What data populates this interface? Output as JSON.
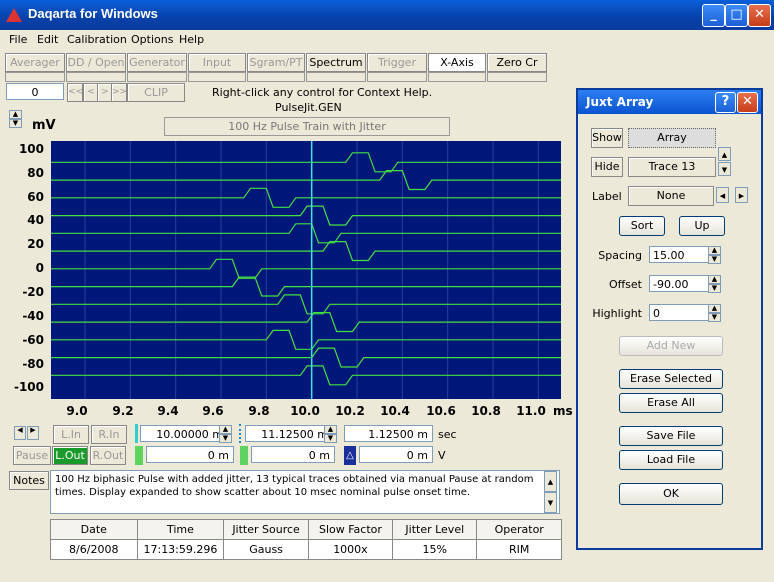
{
  "window": {
    "title": "Daqarta for Windows"
  },
  "menu": [
    "File",
    "Edit",
    "Calibration",
    "Options",
    "Help"
  ],
  "toolbar": {
    "buttons": [
      "Averager",
      "DD / Open",
      "Generator",
      "Input",
      "Sgram/PT",
      "Spectrum",
      "Trigger",
      "X-Axis",
      "Zero Cr"
    ],
    "counter": "0",
    "nav": [
      "<<",
      "<",
      ">",
      ">>"
    ],
    "clip": "CLIP",
    "help_text": "Right-click any control for Context Help.",
    "file_name": "PulseJit.GEN",
    "subtitle": "100 Hz Pulse Train with Jitter"
  },
  "y_unit": "mV",
  "x_unit": "ms",
  "chart_data": {
    "type": "line",
    "xlim": [
      8.85,
      11.1
    ],
    "ylim": [
      -110,
      108
    ],
    "x_ticks": [
      "9.0",
      "9.2",
      "9.4",
      "9.6",
      "9.8",
      "10.0",
      "10.2",
      "10.4",
      "10.6",
      "10.8",
      "11.0"
    ],
    "y_ticks": [
      "100",
      "80",
      "60",
      "40",
      "20",
      "0",
      "-20",
      "-40",
      "-60",
      "-80",
      "-100"
    ],
    "cursor_x": 10.0,
    "trace_color": "#40e040",
    "background": "#00177a",
    "series": [
      {
        "offset": 90,
        "onset": 10.15
      },
      {
        "offset": 75,
        "onset": 10.3
      },
      {
        "offset": 60,
        "onset": 9.7
      },
      {
        "offset": 45,
        "onset": 9.95
      },
      {
        "offset": 30,
        "onset": 9.9
      },
      {
        "offset": 15,
        "onset": 10.05
      },
      {
        "offset": 0,
        "onset": 9.55
      },
      {
        "offset": -15,
        "onset": 9.65
      },
      {
        "offset": -30,
        "onset": 9.85
      },
      {
        "offset": -45,
        "onset": 9.98
      },
      {
        "offset": -60,
        "onset": 9.8
      },
      {
        "offset": -75,
        "onset": 10.0
      },
      {
        "offset": -90,
        "onset": 9.95
      }
    ]
  },
  "controls": {
    "l_in": "L.In",
    "r_in": "R.In",
    "pause": "Pause",
    "l_out": "L.Out",
    "r_out": "R.Out",
    "cursor1": "10.00000 m",
    "cursor2": "11.12500 m",
    "delta": "1.12500 m",
    "sec_unit": "sec",
    "val1": "0 m",
    "val2": "0 m",
    "val3": "0 m",
    "v_unit": "V"
  },
  "notes": {
    "label": "Notes",
    "text": "100 Hz biphasic Pulse with added jitter, 13 typical traces obtained via manual Pause at random times. Display expanded to show scatter about 10 msec nominal pulse onset time."
  },
  "info_table": {
    "headers": [
      "Date",
      "Time",
      "Jitter Source",
      "Slow Factor",
      "Jitter Level",
      "Operator"
    ],
    "values": [
      "8/6/2008",
      "17:13:59.296",
      "Gauss",
      "1000x",
      "15%",
      "RIM"
    ]
  },
  "juxt": {
    "title": "Juxt Array",
    "show": "Show",
    "show_val": "Array",
    "hide": "Hide",
    "hide_val": "Trace 13",
    "label": "Label",
    "label_val": "None",
    "sort": "Sort",
    "up": "Up",
    "spacing_label": "Spacing",
    "spacing": "15.00",
    "offset_label": "Offset",
    "offset": "-90.00",
    "highlight_label": "Highlight",
    "highlight": "0",
    "add_new": "Add New",
    "erase_selected": "Erase Selected",
    "erase_all": "Erase All",
    "save_file": "Save File",
    "load_file": "Load File",
    "ok": "OK"
  }
}
